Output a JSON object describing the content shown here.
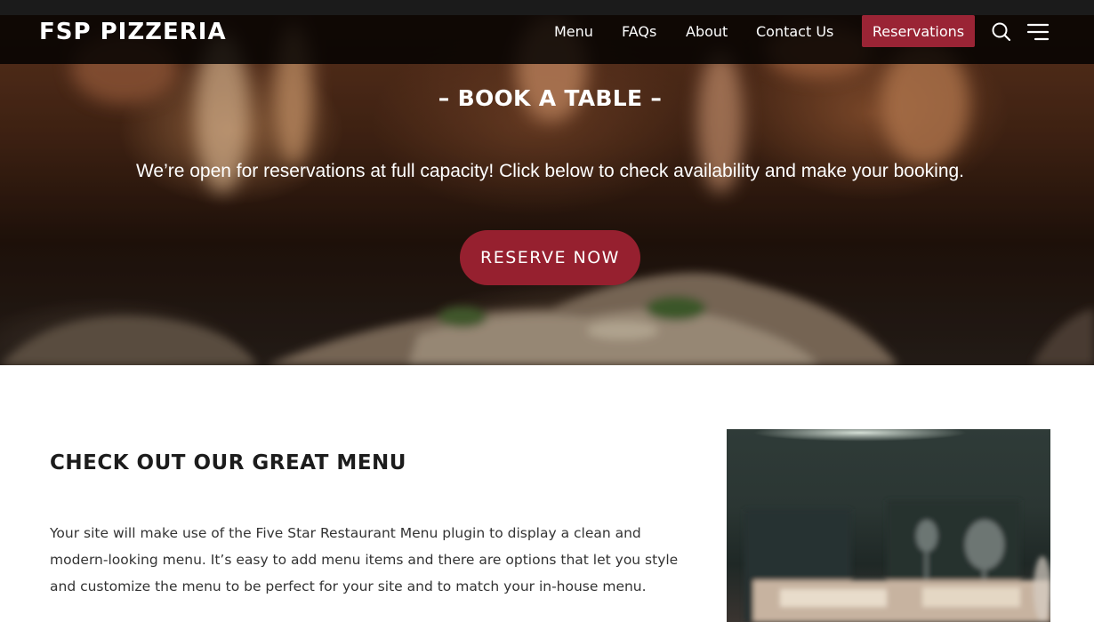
{
  "site": {
    "logo": "FSP PIZZERIA"
  },
  "nav": {
    "items": [
      {
        "label": "Menu"
      },
      {
        "label": "FAQs"
      },
      {
        "label": "About"
      },
      {
        "label": "Contact Us"
      }
    ],
    "reservations_label": "Reservations",
    "search_icon": "search-icon",
    "menu_icon": "hamburger-menu-icon",
    "accent": "#9a2435"
  },
  "hero": {
    "title": "– BOOK A TABLE –",
    "text": "We’re open for reservations at full capacity! Click below to check availability and make your booking.",
    "button_label": "RESERVE NOW"
  },
  "menu_section": {
    "heading": "CHECK OUT OUR GREAT MENU",
    "body": "Your site will make use of the Five Star Restaurant Menu plugin to display a clean and modern-looking menu. It’s easy to add menu items and there are options that let you style and customize the menu to be perfect for your site and to match your in-house menu."
  }
}
